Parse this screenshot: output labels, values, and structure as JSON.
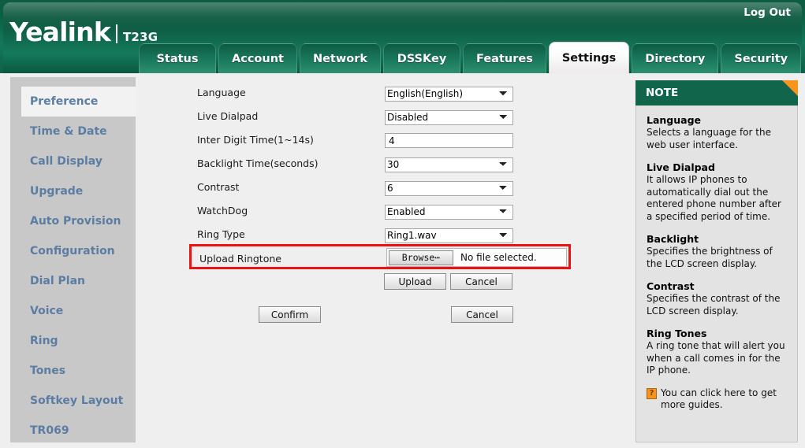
{
  "header": {
    "brand": "Yealink",
    "model": "T23G",
    "logout_label": "Log Out"
  },
  "tabs": [
    {
      "label": "Status",
      "active": false
    },
    {
      "label": "Account",
      "active": false
    },
    {
      "label": "Network",
      "active": false
    },
    {
      "label": "DSSKey",
      "active": false
    },
    {
      "label": "Features",
      "active": false
    },
    {
      "label": "Settings",
      "active": true
    },
    {
      "label": "Directory",
      "active": false
    },
    {
      "label": "Security",
      "active": false
    }
  ],
  "sidebar": {
    "items": [
      {
        "label": "Preference",
        "active": true
      },
      {
        "label": "Time & Date",
        "active": false
      },
      {
        "label": "Call Display",
        "active": false
      },
      {
        "label": "Upgrade",
        "active": false
      },
      {
        "label": "Auto Provision",
        "active": false
      },
      {
        "label": "Configuration",
        "active": false
      },
      {
        "label": "Dial Plan",
        "active": false
      },
      {
        "label": "Voice",
        "active": false
      },
      {
        "label": "Ring",
        "active": false
      },
      {
        "label": "Tones",
        "active": false
      },
      {
        "label": "Softkey Layout",
        "active": false
      },
      {
        "label": "TR069",
        "active": false
      }
    ]
  },
  "form": {
    "rows": [
      {
        "label": "Language",
        "type": "select",
        "value": "English(English)"
      },
      {
        "label": "Live Dialpad",
        "type": "select",
        "value": "Disabled"
      },
      {
        "label": "Inter Digit Time(1~14s)",
        "type": "text",
        "value": "4"
      },
      {
        "label": "Backlight Time(seconds)",
        "type": "select",
        "value": "30"
      },
      {
        "label": "Contrast",
        "type": "select",
        "value": "6"
      },
      {
        "label": "WatchDog",
        "type": "select",
        "value": "Enabled"
      },
      {
        "label": "Ring Type",
        "type": "select",
        "value": "Ring1.wav"
      }
    ],
    "upload": {
      "label": "Upload Ringtone",
      "browse_label": "Browse⋯",
      "file_status": "No file selected.",
      "upload_label": "Upload",
      "cancel_label": "Cancel",
      "highlight_color": "#ee1111"
    },
    "confirm_label": "Confirm",
    "cancel_label": "Cancel"
  },
  "note": {
    "title": "NOTE",
    "blocks": [
      {
        "title": "Language",
        "text": "Selects a language for the web user interface."
      },
      {
        "title": "Live Dialpad",
        "text": "It allows IP phones to automatically dial out the entered phone number after a specified period of time."
      },
      {
        "title": "Backlight",
        "text": "Specifies the brightness of the LCD screen display."
      },
      {
        "title": "Contrast",
        "text": "Specifies the contrast of the LCD screen display."
      },
      {
        "title": "Ring Tones",
        "text": "A ring tone that will alert you when a call comes in for the IP phone."
      }
    ],
    "footer_text": "You can click here to get more guides.",
    "help_icon_glyph": "?"
  },
  "colors": {
    "brand_green": "#10654b",
    "accent_orange": "#f7941e",
    "sidebar_link": "#5c7da3"
  }
}
